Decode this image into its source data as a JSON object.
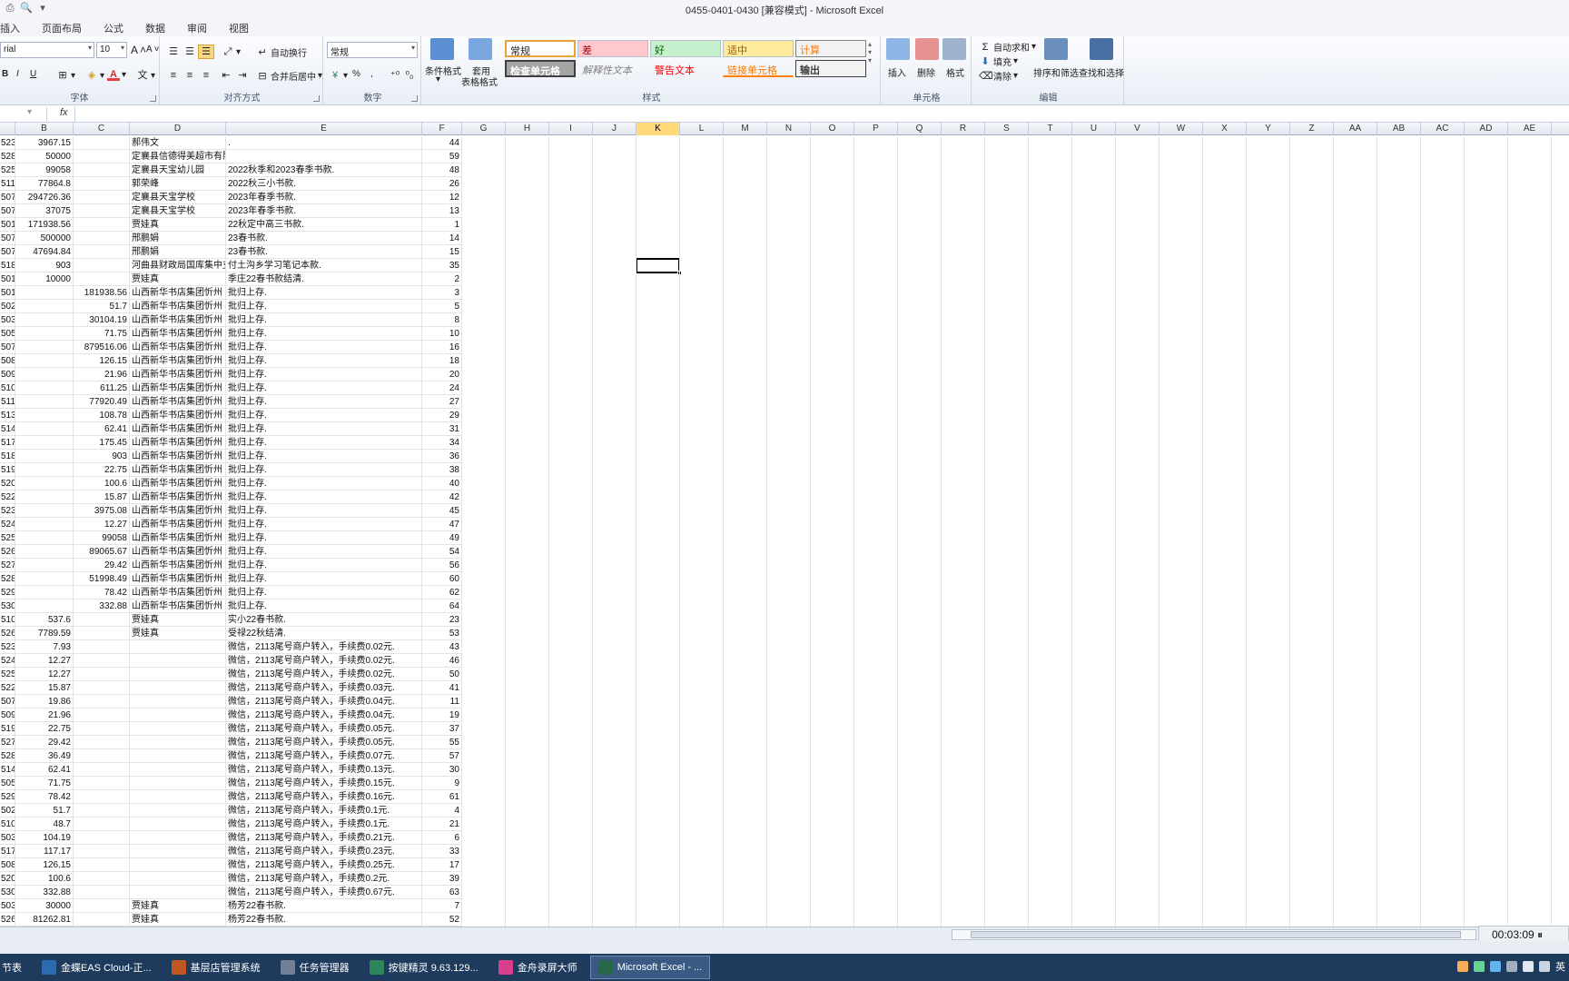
{
  "window": {
    "title": "0455-0401-0430  [兼容模式]  -  Microsoft Excel"
  },
  "menu_tabs": [
    "插入",
    "页面布局",
    "公式",
    "数据",
    "审阅",
    "视图"
  ],
  "ribbon": {
    "font_name": "rial",
    "font_size": "10",
    "bold": "B",
    "italic": "I",
    "underline": "U",
    "font_grow": "A",
    "font_shrink": "A",
    "wrap_text": "自动换行",
    "merge_center": "合并后居中",
    "number_format": "常规",
    "percent": "%",
    "comma": ",",
    "conditional_format": "条件格式",
    "format_table_1": "套用",
    "format_table_2": "表格格式",
    "styles": [
      "常规",
      "差",
      "好",
      "适中",
      "计算",
      "检查单元格",
      "解释性文本",
      "警告文本",
      "链接单元格",
      "输出"
    ],
    "insert": "插入",
    "delete": "删除",
    "format": "格式",
    "autosum": "自动求和",
    "fill": "填充",
    "clear": "清除",
    "sort_filter": "排序和筛选",
    "find_select": "查找和选择",
    "group_labels": [
      "字体",
      "对齐方式",
      "数字",
      "样式",
      "单元格",
      "编辑"
    ]
  },
  "formula_bar": {
    "fx": "fx"
  },
  "columns": [
    "B",
    "C",
    "D",
    "E",
    "F",
    "G",
    "H",
    "I",
    "J",
    "K",
    "L",
    "M",
    "N",
    "O",
    "P",
    "Q",
    "R",
    "S",
    "T",
    "U",
    "V",
    "W",
    "X",
    "Y",
    "Z",
    "AA",
    "AB",
    "AC",
    "AD",
    "AE"
  ],
  "active_column": "K",
  "rows": [
    [
      "523",
      "3967.15",
      "",
      "郝伟文",
      ".",
      "44"
    ],
    [
      "528",
      "50000",
      "",
      "定襄县信德得美超市有限",
      "",
      "59"
    ],
    [
      "525",
      "99058",
      "",
      "定襄县天宝幼儿园",
      "2022秋季和2023春季书款.",
      "48"
    ],
    [
      "511",
      "77864.8",
      "",
      "郭荣峰",
      "2022秋三小书款.",
      "26"
    ],
    [
      "507",
      "294726.36",
      "",
      "定襄县天宝学校",
      "2023年春季书款.",
      "12"
    ],
    [
      "507",
      "37075",
      "",
      "定襄县天宝学校",
      "2023年春季书款.",
      "13"
    ],
    [
      "501",
      "171938.56",
      "",
      "贾娃真",
      "22秋定中高三书款.",
      "1"
    ],
    [
      "507",
      "500000",
      "",
      "邢鹏娟",
      "23春书款.",
      "14"
    ],
    [
      "507",
      "47694.84",
      "",
      "邢鹏娟",
      "23春书款.",
      "15"
    ],
    [
      "518",
      "903",
      "",
      "河曲县财政局国库集中支",
      "付土沟乡学习笔记本款.",
      "35"
    ],
    [
      "501",
      "10000",
      "",
      "贾娃真",
      "季庄22春书款结清.",
      "2"
    ],
    [
      "501",
      "",
      "181938.56",
      "山西新华书店集团忻州",
      "批归上存.",
      "3"
    ],
    [
      "502",
      "",
      "51.7",
      "山西新华书店集团忻州",
      "批归上存.",
      "5"
    ],
    [
      "503",
      "",
      "30104.19",
      "山西新华书店集团忻州",
      "批归上存.",
      "8"
    ],
    [
      "505",
      "",
      "71.75",
      "山西新华书店集团忻州",
      "批归上存.",
      "10"
    ],
    [
      "507",
      "",
      "879516.06",
      "山西新华书店集团忻州",
      "批归上存.",
      "16"
    ],
    [
      "508",
      "",
      "126.15",
      "山西新华书店集团忻州",
      "批归上存.",
      "18"
    ],
    [
      "509",
      "",
      "21.96",
      "山西新华书店集团忻州",
      "批归上存.",
      "20"
    ],
    [
      "510",
      "",
      "611.25",
      "山西新华书店集团忻州",
      "批归上存.",
      "24"
    ],
    [
      "511",
      "",
      "77920.49",
      "山西新华书店集团忻州",
      "批归上存.",
      "27"
    ],
    [
      "513",
      "",
      "108.78",
      "山西新华书店集团忻州",
      "批归上存.",
      "29"
    ],
    [
      "514",
      "",
      "62.41",
      "山西新华书店集团忻州",
      "批归上存.",
      "31"
    ],
    [
      "517",
      "",
      "175.45",
      "山西新华书店集团忻州",
      "批归上存.",
      "34"
    ],
    [
      "518",
      "",
      "903",
      "山西新华书店集团忻州",
      "批归上存.",
      "36"
    ],
    [
      "519",
      "",
      "22.75",
      "山西新华书店集团忻州",
      "批归上存.",
      "38"
    ],
    [
      "520",
      "",
      "100.6",
      "山西新华书店集团忻州",
      "批归上存.",
      "40"
    ],
    [
      "522",
      "",
      "15.87",
      "山西新华书店集团忻州",
      "批归上存.",
      "42"
    ],
    [
      "523",
      "",
      "3975.08",
      "山西新华书店集团忻州",
      "批归上存.",
      "45"
    ],
    [
      "524",
      "",
      "12.27",
      "山西新华书店集团忻州",
      "批归上存.",
      "47"
    ],
    [
      "525",
      "",
      "99058",
      "山西新华书店集团忻州",
      "批归上存.",
      "49"
    ],
    [
      "526",
      "",
      "89065.67",
      "山西新华书店集团忻州",
      "批归上存.",
      "54"
    ],
    [
      "527",
      "",
      "29.42",
      "山西新华书店集团忻州",
      "批归上存.",
      "56"
    ],
    [
      "528",
      "",
      "51998.49",
      "山西新华书店集团忻州",
      "批归上存.",
      "60"
    ],
    [
      "529",
      "",
      "78.42",
      "山西新华书店集团忻州",
      "批归上存.",
      "62"
    ],
    [
      "530",
      "",
      "332.88",
      "山西新华书店集团忻州",
      "批归上存.",
      "64"
    ],
    [
      "510",
      "537.6",
      "",
      "贾娃真",
      "实小22春书款.",
      "23"
    ],
    [
      "526",
      "7789.59",
      "",
      "贾娃真",
      "受禄22秋结清.",
      "53"
    ],
    [
      "523",
      "7.93",
      "",
      "",
      "微信，2113尾号商户转入，手续费0.02元.",
      "43"
    ],
    [
      "524",
      "12.27",
      "",
      "",
      "微信，2113尾号商户转入，手续费0.02元.",
      "46"
    ],
    [
      "525",
      "12.27",
      "",
      "",
      "微信，2113尾号商户转入，手续费0.02元.",
      "50"
    ],
    [
      "522",
      "15.87",
      "",
      "",
      "微信，2113尾号商户转入，手续费0.03元.",
      "41"
    ],
    [
      "507",
      "19.86",
      "",
      "",
      "微信，2113尾号商户转入，手续费0.04元.",
      "11"
    ],
    [
      "509",
      "21.96",
      "",
      "",
      "微信，2113尾号商户转入，手续费0.04元.",
      "19"
    ],
    [
      "519",
      "22.75",
      "",
      "",
      "微信，2113尾号商户转入，手续费0.05元.",
      "37"
    ],
    [
      "527",
      "29.42",
      "",
      "",
      "微信，2113尾号商户转入，手续费0.05元.",
      "55"
    ],
    [
      "528",
      "36.49",
      "",
      "",
      "微信，2113尾号商户转入，手续费0.07元.",
      "57"
    ],
    [
      "514",
      "62.41",
      "",
      "",
      "微信，2113尾号商户转入，手续费0.13元.",
      "30"
    ],
    [
      "505",
      "71.75",
      "",
      "",
      "微信，2113尾号商户转入，手续费0.15元.",
      "9"
    ],
    [
      "529",
      "78.42",
      "",
      "",
      "微信，2113尾号商户转入，手续费0.16元.",
      "61"
    ],
    [
      "502",
      "51.7",
      "",
      "",
      "微信，2113尾号商户转入，手续费0.1元.",
      "4"
    ],
    [
      "510",
      "48.7",
      "",
      "",
      "微信，2113尾号商户转入，手续费0.1元.",
      "21"
    ],
    [
      "503",
      "104.19",
      "",
      "",
      "微信，2113尾号商户转入，手续费0.21元.",
      "6"
    ],
    [
      "517",
      "117.17",
      "",
      "",
      "微信，2113尾号商户转入，手续费0.23元.",
      "33"
    ],
    [
      "508",
      "126.15",
      "",
      "",
      "微信，2113尾号商户转入，手续费0.25元.",
      "17"
    ],
    [
      "520",
      "100.6",
      "",
      "",
      "微信，2113尾号商户转入，手续费0.2元.",
      "39"
    ],
    [
      "530",
      "332.88",
      "",
      "",
      "微信，2113尾号商户转入，手续费0.67元.",
      "63"
    ],
    [
      "503",
      "30000",
      "",
      "贾娃真",
      "杨芳22春书款.",
      "7"
    ],
    [
      "526",
      "81262.81",
      "",
      "贾娃真",
      "杨芳22春书款.",
      "52"
    ]
  ],
  "timer": "00:03:09",
  "taskbar": {
    "start": "节表",
    "items": [
      {
        "label": "金蝶EAS Cloud-正...",
        "color": "#2b6cb0"
      },
      {
        "label": "基层店管理系统",
        "color": "#c05621"
      },
      {
        "label": "任务管理器",
        "color": "#718096"
      },
      {
        "label": "按键精灵 9.63.129...",
        "color": "#2f855a"
      },
      {
        "label": "金舟录屏大师",
        "color": "#d53f8c"
      },
      {
        "label": "Microsoft Excel - ...",
        "color": "#276749"
      }
    ],
    "tray_lang": "英"
  },
  "colors": {
    "accent_active_col": "#ffd97a",
    "taskbar_bg": "#1e3a5c"
  }
}
